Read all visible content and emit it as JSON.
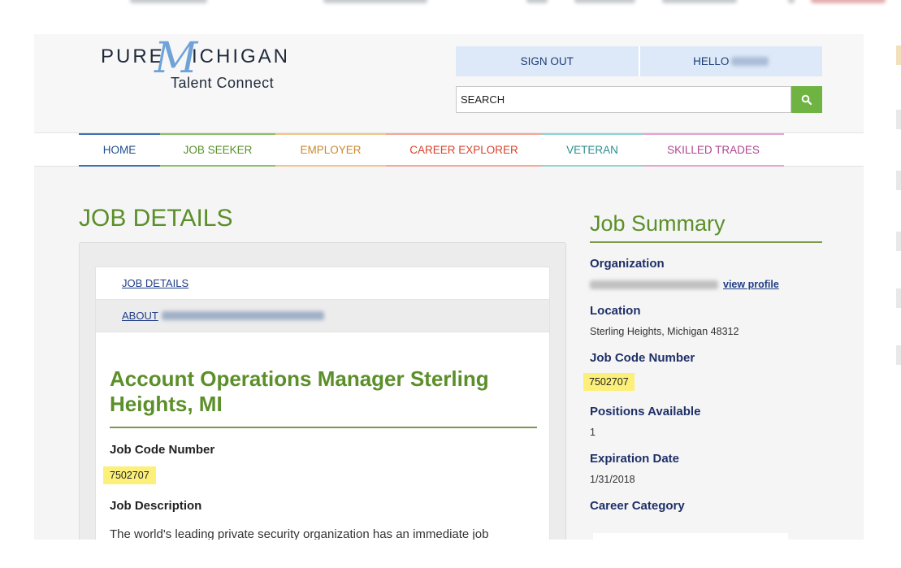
{
  "header": {
    "logo": {
      "word1": "PURE",
      "letter": "M",
      "word2": "ICHIGAN",
      "tagline": "Talent Connect"
    },
    "sign_out": "SIGN OUT",
    "hello": "HELLO",
    "search": {
      "placeholder": "SEARCH"
    }
  },
  "nav": {
    "items": [
      {
        "label": "HOME",
        "color": "#1f4e8c"
      },
      {
        "label": "JOB SEEKER",
        "color": "#5b8f2a"
      },
      {
        "label": "EMPLOYER",
        "color": "#c98a2b"
      },
      {
        "label": "CAREER EXPLORER",
        "color": "#d9432b"
      },
      {
        "label": "VETERAN",
        "color": "#2b8f8f"
      },
      {
        "label": "SKILLED TRADES",
        "color": "#b0478f"
      }
    ]
  },
  "main": {
    "title": "JOB DETAILS",
    "tabs": [
      {
        "label": "JOB DETAILS"
      },
      {
        "label": "ABOUT"
      }
    ],
    "job_title": "Account Operations Manager Sterling Heights, MI",
    "job_code_label": "Job Code Number",
    "job_code": "7502707",
    "job_description_label": "Job Description",
    "job_description": "The world's leading private security organization has an immediate job"
  },
  "summary": {
    "title": "Job Summary",
    "organization_label": "Organization",
    "view_profile": "view profile",
    "location_label": "Location",
    "location": "Sterling Heights, Michigan 48312",
    "job_code_label": "Job Code Number",
    "job_code": "7502707",
    "positions_label": "Positions Available",
    "positions": "1",
    "expiration_label": "Expiration Date",
    "expiration": "1/31/2018",
    "career_category_label": "Career Category"
  },
  "colors": {
    "brand_green": "#5b8f2a",
    "search_green": "#6fb342",
    "highlight": "#fcf07a",
    "link_blue": "#1f3e86"
  }
}
